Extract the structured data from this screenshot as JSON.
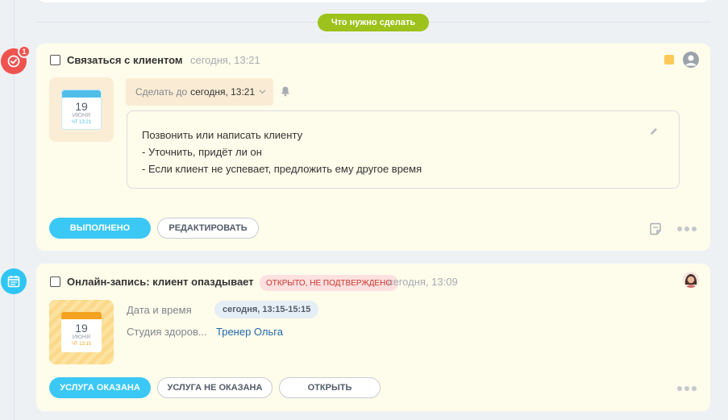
{
  "section_label": "Что нужно сделать",
  "task_card": {
    "badge_count": "1",
    "title": "Связаться с клиентом",
    "created_time": "сегодня, 13:21",
    "calendar": {
      "day": "19",
      "month": "ИЮНЯ",
      "time": "ЧТ 13:21"
    },
    "deadline_prefix": "Сделать до",
    "deadline_value": "сегодня, 13:21",
    "description_lines": [
      "Позвонить или написать клиенту",
      "- Уточнить, придёт ли он",
      "- Если клиент не успевает, предложить ему другое время"
    ],
    "done_button": "ВЫПОЛНЕНО",
    "edit_button": "РЕДАКТИРОВАТЬ"
  },
  "booking_card": {
    "title": "Онлайн-запись: клиент опаздывает",
    "status": "ОТКРЫТО, НЕ ПОДТВЕРЖДЕНО",
    "created_time": "сегодня, 13:09",
    "calendar": {
      "day": "19",
      "month": "ИЮНЯ",
      "time": "ЧТ 13:15"
    },
    "datetime_label": "Дата и время",
    "datetime_value": "сегодня, 13:15-15:15",
    "studio_label": "Студия здоров...",
    "trainer": "Тренер Ольга",
    "service_done_button": "УСЛУГА ОКАЗАНА",
    "service_not_done_button": "УСЛУГА НЕ ОКАЗАНА",
    "open_button": "ОТКРЫТЬ"
  },
  "colors": {
    "accent_blue": "#3bc8f5",
    "section_green": "#9dc21b",
    "alert_red": "#ef5350",
    "card_bg": "#fefcea",
    "status_red_text": "#c8342c"
  },
  "icons": [
    "checkmark-icon",
    "calendar-list-icon",
    "bell-icon",
    "pencil-icon",
    "user-icon",
    "note-icon",
    "more-icon",
    "color-tag-icon"
  ]
}
